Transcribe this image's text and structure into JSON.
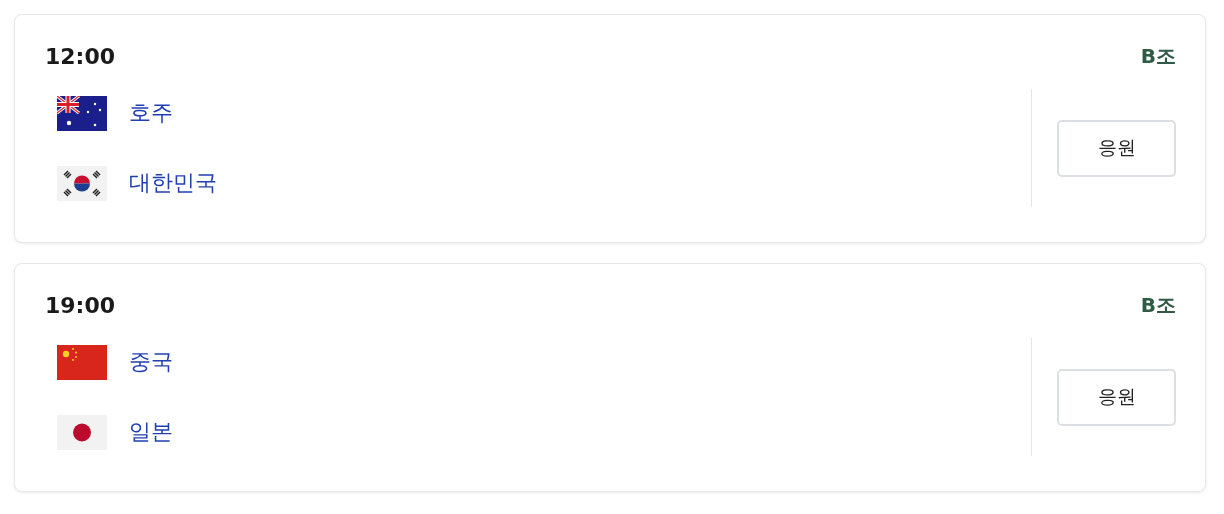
{
  "matches": [
    {
      "time": "12:00",
      "group": "B조",
      "teams": [
        {
          "name": "호주",
          "kind": "au"
        },
        {
          "name": "대한민국",
          "kind": "kr"
        }
      ],
      "button": "응원"
    },
    {
      "time": "19:00",
      "group": "B조",
      "teams": [
        {
          "name": "중국",
          "kind": "cn"
        },
        {
          "name": "일본",
          "kind": "jp"
        }
      ],
      "button": "응원"
    }
  ]
}
